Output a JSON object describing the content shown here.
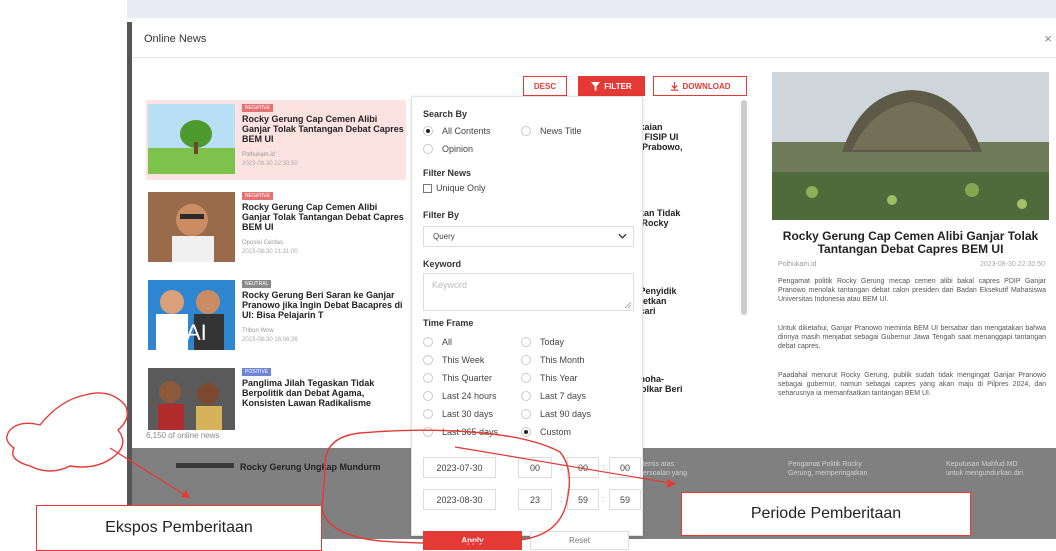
{
  "modal": {
    "title": "Online News",
    "close": "×"
  },
  "toolbar": {
    "desc_label": "DESC",
    "filter_label": "FILTER",
    "download_label": "DOWNLOAD"
  },
  "news": [
    {
      "badge": "NEGATIVE",
      "title": "Rocky Gerung Cap Cemen Alibi Ganjar Tolak Tantangan Debat Capres BEM UI",
      "source": "Polhukam.id",
      "date": "2023-08-30 22:30:50"
    },
    {
      "badge": "NEGATIVE",
      "title": "Rocky Gerung Cap Cemen Alibi Ganjar Tolak Tantangan Debat Capres BEM UI",
      "source": "Oposisi Cerdas",
      "date": "2023-08-30 21:31:00"
    },
    {
      "badge": "NEUTRAL",
      "title": "Rocky Gerung Beri Saran ke Ganjar Pranowo jika Ingin Debat Bacapres di UI: Bisa Pelajarin T",
      "source": "Tribun Wow",
      "date": "2023-08-30 16:06:36"
    },
    {
      "badge": "POSITIVE",
      "title": "Panglima Jilah Tegaskan Tidak Berpolitik dan Debat Agama, Konsisten Lawan Radikalisme",
      "source": "",
      "date": ""
    }
  ],
  "right_fragments": [
    "gkaian",
    "di FISIP UI",
    "n Prabowo,",
    "skan Tidak",
    "I, Rocky",
    ": Penyidik",
    "rgetkan",
    "ncari",
    "onoha-",
    "Golkar Beri"
  ],
  "list_count": "6,150 of online news",
  "dim": {
    "headline": "Rocky Gerung Ungkap Mundurm",
    "texts": [
      "si akademis atas",
      "mlah persoalan yang",
      "Pengamat Politik Rocky",
      "Gerung, memperingatkan",
      "Keputusan Mahfud MD",
      "untuk mengundurkan diri"
    ]
  },
  "detail": {
    "title": "Rocky Gerung Cap Cemen Alibi Ganjar Tolak Tantangan Debat Capres BEM UI",
    "source": "Polhukam.id",
    "date": "2023-08-30 22:30:50",
    "paragraphs": [
      "Pengamat politik Rocky Gerung mecap cemen alibi bakal capres PDIP Ganjar Pranowo menolak tantangan debat calon presiden dari Badan Eksekutif Mahasiswa Universitas Indonesia atau BEM UI.",
      "Untuk diketahui, Ganjar Pranowo meminta BEM UI bersabar dan mengatakan bahwa dirinya masih menjabat sebagai Gubernur Jawa Tengah saat menanggapi tantangan debat capres.",
      "Paadahal menurut Rocky Gerung, publik sudah tidak mengingat Ganjar Pranowo sebagai gubernur, namun sebagai capres yang akan maju di Pilpres 2024, dan seharusnya ia memanfaatkan tantangan BEM UI."
    ]
  },
  "filter": {
    "search_by_label": "Search By",
    "search_by": [
      "All Contents",
      "News Title",
      "Opinion"
    ],
    "filter_news_label": "Filter News",
    "unique_only": "Unique Only",
    "filter_by_label": "Filter By",
    "filter_by_value": "Query",
    "keyword_label": "Keyword",
    "keyword_placeholder": "Keyword",
    "time_frame_label": "Time Frame",
    "time_frames": [
      "All",
      "Today",
      "This Week",
      "This Month",
      "This Quarter",
      "This Year",
      "Last 24 hours",
      "Last 7 days",
      "Last 30 days",
      "Last 90 days",
      "Last 365 days",
      "Custom"
    ],
    "start_date": "2023-07-30",
    "start_h": "00",
    "start_m": "00",
    "start_s": "00",
    "end_date": "2023-08-30",
    "end_h": "23",
    "end_m": "59",
    "end_s": "59",
    "colon": ":",
    "apply": "Apply",
    "reset": "Reset"
  },
  "annotations": {
    "left": "Ekspos Pemberitaan",
    "right": "Periode Pemberitaan"
  },
  "colors": {
    "accent": "#e53935",
    "annotation": "#e53935"
  }
}
